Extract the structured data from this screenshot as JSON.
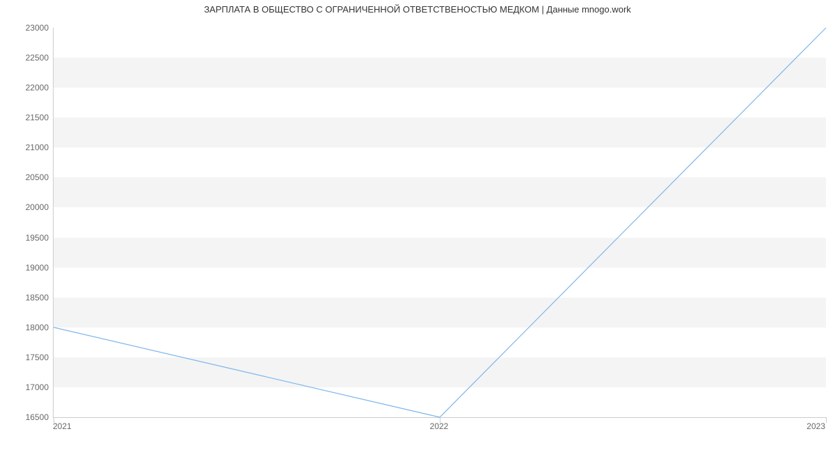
{
  "chart_data": {
    "type": "line",
    "title": "ЗАРПЛАТА В ОБЩЕСТВО С ОГРАНИЧЕННОЙ ОТВЕТСТВЕНОСТЬЮ МЕДКОМ | Данные mnogo.work",
    "xlabel": "",
    "ylabel": "",
    "x": [
      "2021",
      "2022",
      "2023"
    ],
    "values": [
      18000,
      16500,
      23000
    ],
    "ylim": [
      16500,
      23000
    ],
    "yticks": [
      16500,
      17000,
      17500,
      18000,
      18500,
      19000,
      19500,
      20000,
      20500,
      21000,
      21500,
      22000,
      22500,
      23000
    ],
    "line_color": "#7cb5ec",
    "band_color": "#f4f4f4"
  }
}
